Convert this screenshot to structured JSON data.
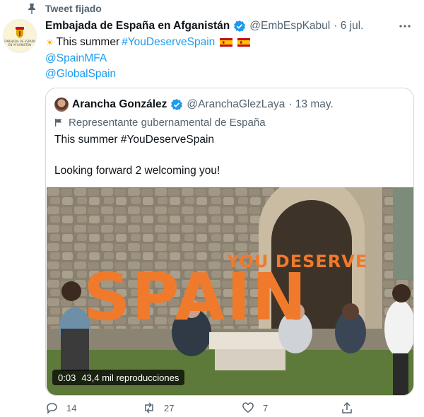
{
  "pinned_label": "Tweet fijado",
  "tweet": {
    "author_name": "Embajada de España en Afganistán",
    "handle": "@EmbEspKabul",
    "date": "· 6 jul.",
    "avatar_text": "EMBAJADA DE ESPAÑA EN AFGANISTÁN",
    "text_line1": "This summer",
    "hashtag": "#YouDeserveSpain",
    "mention1": "@SpainMFA",
    "mention2": "@GlobalSpain"
  },
  "quote": {
    "author_name": "Arancha González",
    "handle": "@AranchaGlezLaya",
    "date": "· 13 may.",
    "label": "Representante gubernamental de España",
    "text_line1": "This summer #YouDeserveSpain",
    "text_line2": "Looking forward 2 welcoming you!",
    "media": {
      "overlay_small": "YOU DESERVE",
      "overlay_big": "SPAIN",
      "duration": "0:03",
      "views": "43,4 mil reproducciones"
    }
  },
  "actions": {
    "replies": "14",
    "retweets": "27",
    "likes": "7"
  },
  "colors": {
    "accent": "#1d9bf0",
    "muted": "#536471",
    "overlay_orange": "#f07a2c"
  }
}
